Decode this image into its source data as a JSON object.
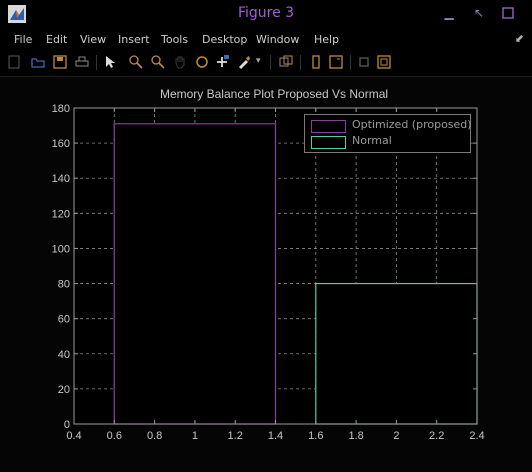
{
  "window": {
    "title": "Figure 3"
  },
  "menu": {
    "items": [
      "File",
      "Edit",
      "View",
      "Insert",
      "Tools",
      "Desktop",
      "Window",
      "Help"
    ]
  },
  "toolbar": {
    "icons": [
      "new-figure-icon",
      "open-file-icon",
      "save-icon",
      "print-icon",
      "edit-plot-arrow-icon",
      "zoom-in-icon",
      "zoom-out-icon",
      "pan-hand-icon",
      "rotate-3d-icon",
      "data-cursor-icon",
      "brush-icon",
      "link-plot-icon",
      "insert-colorbar-icon",
      "insert-legend-icon",
      "hide-plot-tools-icon",
      "show-plot-tools-icon"
    ]
  },
  "colors": {
    "optimized": "#8a3f99",
    "normal": "#4fcfa0",
    "grid": "#8a8a8a",
    "axis": "#9a9a9a",
    "text": "#c8c8c8"
  },
  "chart_data": {
    "type": "bar",
    "title": "Memory Balance Plot Proposed Vs Normal",
    "xlabel": "",
    "ylabel": "",
    "xlim": [
      0.4,
      2.4
    ],
    "ylim": [
      0,
      180
    ],
    "xticks": [
      "0.4",
      "0.6",
      "0.8",
      "1",
      "1.2",
      "1.4",
      "1.6",
      "1.8",
      "2",
      "2.2",
      "2.4"
    ],
    "yticks": [
      "0",
      "20",
      "40",
      "60",
      "80",
      "100",
      "120",
      "140",
      "160",
      "180"
    ],
    "grid": true,
    "legend_location": "top-right",
    "series": [
      {
        "name": "Optimized (proposed)",
        "x": 1,
        "width": 0.8,
        "value": 171,
        "color": "#8a3f99"
      },
      {
        "name": "Normal",
        "x": 2,
        "width": 0.8,
        "value": 80,
        "color": "#4fcfa0"
      }
    ]
  }
}
